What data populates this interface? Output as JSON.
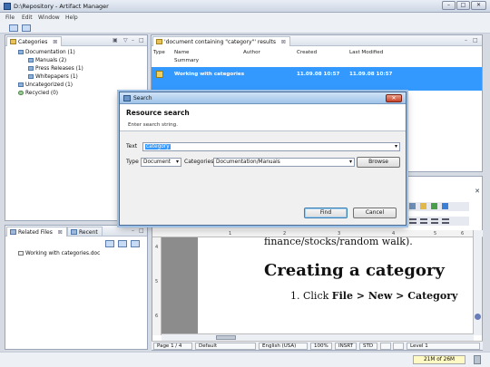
{
  "window": {
    "title": "D:\\Repository - Artifact Manager",
    "buttons": [
      "–",
      "□",
      "✕"
    ]
  },
  "menu": [
    "File",
    "Edit",
    "Window",
    "Help"
  ],
  "categories_pane": {
    "tab_label": "Categories",
    "tree": [
      {
        "label": "Documentation (1)",
        "level": 1
      },
      {
        "label": "Manuals (2)",
        "level": 2
      },
      {
        "label": "Press Releases (1)",
        "level": 2
      },
      {
        "label": "Whitepapers (1)",
        "level": 2
      },
      {
        "label": "Uncategorized (1)",
        "level": 1
      },
      {
        "label": "Recycled (0)",
        "level": 1
      }
    ]
  },
  "results_pane": {
    "tab_label": "'document containing \"category\"' results",
    "columns": [
      "Type",
      "Name",
      "Author",
      "Created",
      "Last Modified"
    ],
    "subheader": "Summary",
    "rows": [
      {
        "name": "Working with categories",
        "author": "",
        "created": "11.09.08 10:57",
        "modified": "11.09.08 10:57"
      }
    ]
  },
  "related_pane": {
    "tabs": [
      "Related Files",
      "Recent"
    ],
    "items": [
      "Working with categories.doc"
    ]
  },
  "document": {
    "ruler_marks": [
      "1",
      "2",
      "3",
      "4",
      "5",
      "6"
    ],
    "vruler_marks": [
      "4",
      "5",
      "6"
    ],
    "line1": "finance/stocks/random walk).",
    "heading": "Creating a category",
    "step_number": "1.",
    "step_prefix": "Click ",
    "step_bold": "File > New > Category"
  },
  "status": {
    "page": "Page 1 / 4",
    "style": "Default",
    "language": "English (USA)",
    "zoom": "100%",
    "insert": "INSRT",
    "std": "STD",
    "level": "Level 1"
  },
  "memory": "21M of 26M",
  "dialog": {
    "title": "Search",
    "close": "✕",
    "heading": "Resource search",
    "subtitle": "Enter search string.",
    "text_label": "Text",
    "text_value": "category",
    "type_label": "Type",
    "type_value": "Document",
    "categories_label": "Categories",
    "categories_value": "Documentation/Manuals",
    "browse": "Browse",
    "find": "Find",
    "cancel": "Cancel"
  }
}
